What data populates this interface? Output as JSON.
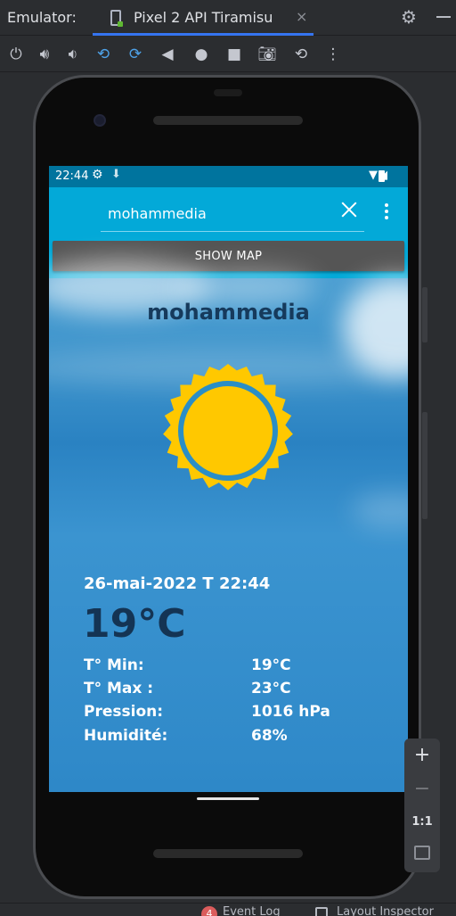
{
  "ide": {
    "title": "Emulator:",
    "tab_label": "Pixel 2 API Tiramisu",
    "tab_close": "×"
  },
  "toolbar": {
    "icons": [
      "power-icon",
      "volume-up-icon",
      "volume-down-icon",
      "rotate-left-icon",
      "rotate-right-icon",
      "back-icon",
      "home-icon",
      "overview-icon",
      "camera-icon",
      "snapshot-icon",
      "more-icon"
    ]
  },
  "status_bar": {
    "time": "22:44"
  },
  "search": {
    "value": "mohammedia"
  },
  "show_map_label": "SHOW MAP",
  "weather": {
    "city": "mohammedia",
    "date": "26-mai-2022 T 22:44",
    "temperature": "19°C",
    "rows": [
      {
        "label": "T° Min:",
        "value": "19°C"
      },
      {
        "label": "T° Max :",
        "value": "23°C"
      },
      {
        "label": "Pression:",
        "value": "1016 hPa"
      },
      {
        "label": "Humidité:",
        "value": "68%"
      }
    ]
  },
  "zoom": {
    "plus": "+",
    "minus": "−",
    "one_to_one": "1:1"
  },
  "bottom_bar": {
    "event_log_count": "4",
    "event_log_label": "Event Log",
    "layout_inspector_label": "Layout Inspector"
  },
  "colors": {
    "app_bar": "#03a9d8",
    "status_bar": "#00749e",
    "sun_yellow": "#ffc800",
    "sun_ring": "#2a8ec6",
    "city_text": "#163a5c"
  }
}
